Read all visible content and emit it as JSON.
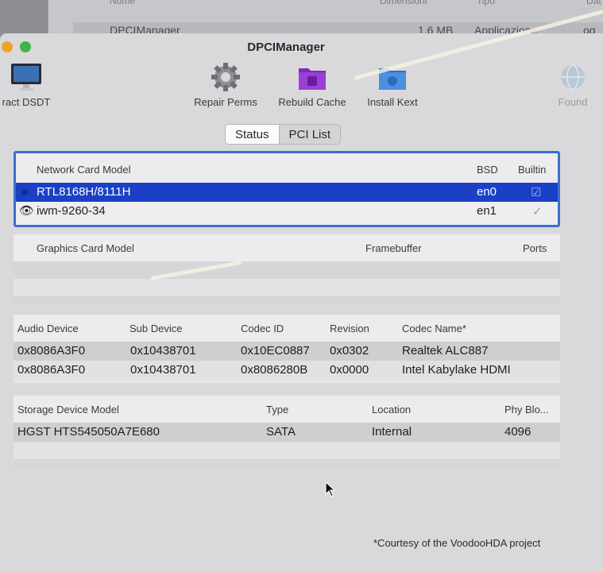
{
  "finder": {
    "col_name": "Nome",
    "col_size": "Dimensioni",
    "col_kind": "Tipo",
    "col_date": "Dat",
    "row_name": "DPCIManager",
    "row_size": "1,6 MB",
    "row_kind": "Applicazione",
    "row_date": "og"
  },
  "window": {
    "title": "DPCIManager"
  },
  "toolbar": {
    "items": [
      {
        "label": "ract DSDT",
        "icon": "monitor-icon"
      },
      {
        "label": "Repair Perms",
        "icon": "gear-icon"
      },
      {
        "label": "Rebuild Cache",
        "icon": "purple-folder-icon"
      },
      {
        "label": "Install Kext",
        "icon": "blue-folder-icon"
      },
      {
        "label": "Found",
        "icon": "globe-icon"
      }
    ]
  },
  "tabs": {
    "status": "Status",
    "pci_list": "PCI List"
  },
  "network": {
    "col_model": "Network Card Model",
    "col_bsd": "BSD",
    "col_builtin": "Builtin",
    "rows": [
      {
        "model": "RTL8168H/8111H",
        "bsd": "en0",
        "builtin": "☑"
      },
      {
        "model": "iwm-9260-34",
        "bsd": "en1",
        "builtin": "✓"
      }
    ]
  },
  "graphics": {
    "col_model": "Graphics Card Model",
    "col_framebuffer": "Framebuffer",
    "col_ports": "Ports"
  },
  "audio": {
    "col_device": "Audio Device",
    "col_sub": "Sub Device",
    "col_codec": "Codec ID",
    "col_revision": "Revision",
    "col_codec_name": "Codec Name*",
    "rows": [
      {
        "device": "0x8086A3F0",
        "sub": "0x10438701",
        "codec": "0x10EC0887",
        "revision": "0x0302",
        "name": "Realtek ALC887"
      },
      {
        "device": "0x8086A3F0",
        "sub": "0x10438701",
        "codec": "0x8086280B",
        "revision": "0x0000",
        "name": "Intel Kabylake HDMI"
      }
    ]
  },
  "storage": {
    "col_model": "Storage Device Model",
    "col_type": "Type",
    "col_location": "Location",
    "col_phy": "Phy Blo...",
    "rows": [
      {
        "model": "HGST HTS545050A7E680",
        "type": "SATA",
        "location": "Internal",
        "phy": "4096"
      }
    ]
  },
  "footnote": "*Courtesy of the VoodooHDA project"
}
